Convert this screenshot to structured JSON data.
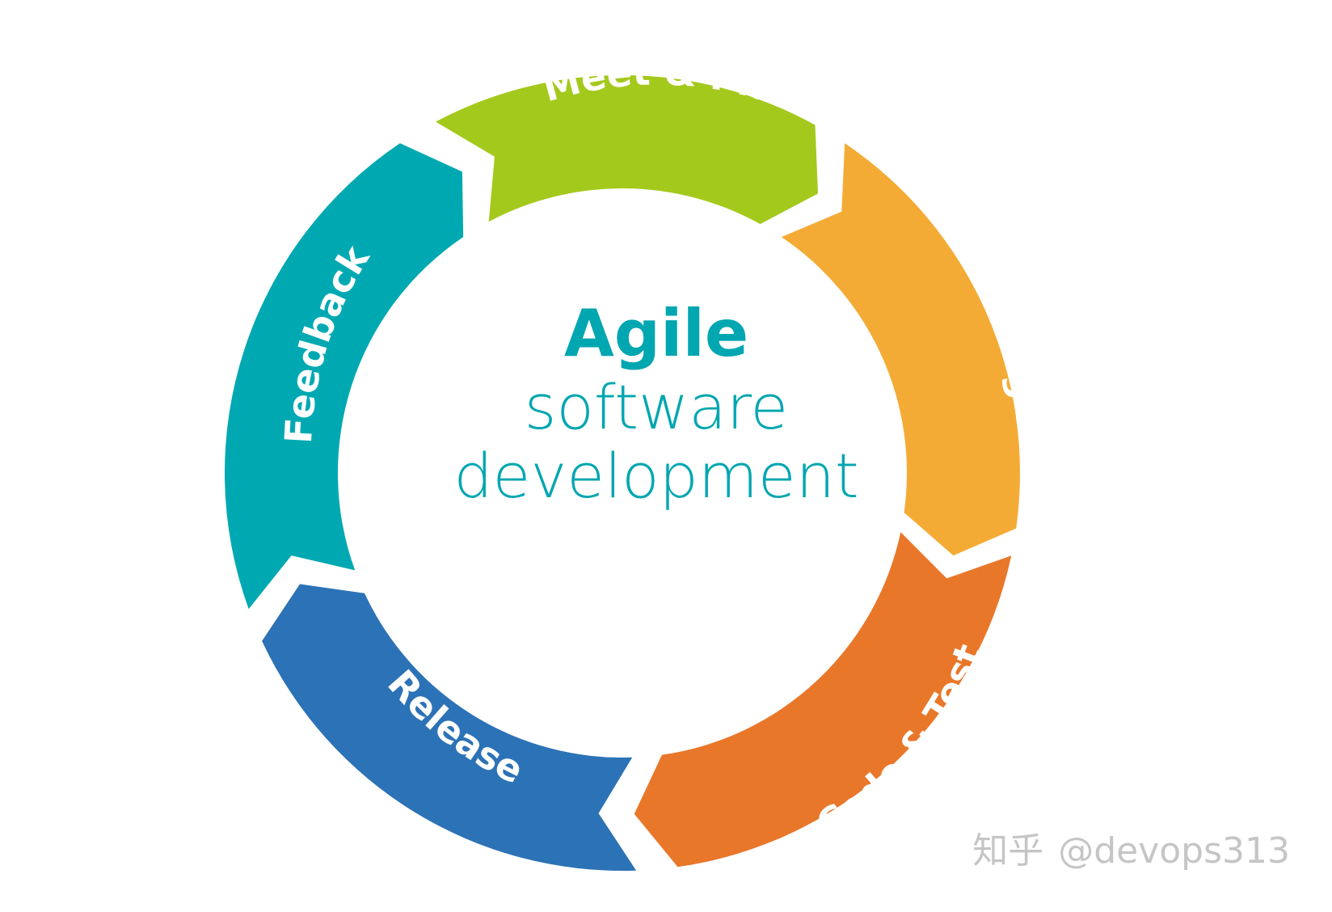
{
  "center": {
    "title": "Agile",
    "line1": "software",
    "line2": "development",
    "color": "#00a6b0"
  },
  "stages": [
    {
      "label": "Meet & Plan",
      "color": "#a4c91d"
    },
    {
      "label": "Design",
      "color": "#f4ab35"
    },
    {
      "label": "Code & Test",
      "color": "#e9772a"
    },
    {
      "label": "Release",
      "color": "#2c72b6"
    },
    {
      "label": "Feedback",
      "color": "#00a9b2"
    }
  ],
  "watermark": {
    "logo_text": "知乎",
    "handle": "@devops313"
  }
}
